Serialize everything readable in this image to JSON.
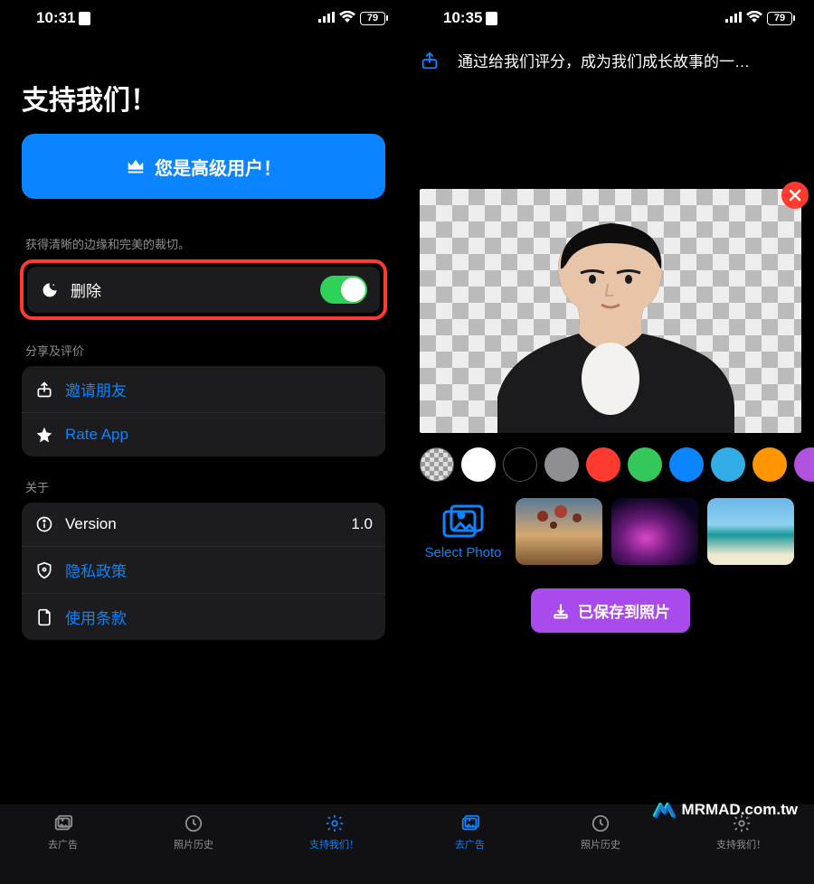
{
  "status": {
    "time_left": "10:31",
    "time_right": "10:35",
    "battery": "79"
  },
  "left": {
    "title": "支持我们！",
    "premium_label": "您是高级用户！",
    "edge_note": "获得清晰的边缘和完美的裁切。",
    "delete_label": "删除",
    "share_header": "分享及评价",
    "invite_label": "邀请朋友",
    "rate_label": "Rate App",
    "about_header": "关于",
    "version_label": "Version",
    "version_value": "1.0",
    "privacy_label": "隐私政策",
    "terms_label": "使用条款"
  },
  "right": {
    "banner_text": "通过给我们评分，成为我们成长故事的一…",
    "select_photo_label": "Select Photo",
    "save_label": "已保存到照片",
    "colors": [
      {
        "name": "transparent",
        "css": "checker"
      },
      {
        "name": "white",
        "css": "white"
      },
      {
        "name": "black",
        "css": "black"
      },
      {
        "name": "gray",
        "css": "gray"
      },
      {
        "name": "red",
        "hex": "#ff3b30"
      },
      {
        "name": "green",
        "hex": "#34c759"
      },
      {
        "name": "blue",
        "hex": "#0a84ff"
      },
      {
        "name": "cyan",
        "hex": "#32ade6"
      },
      {
        "name": "orange",
        "hex": "#ff9500"
      },
      {
        "name": "purple",
        "hex": "#af52de"
      }
    ]
  },
  "tabs": {
    "remove_ads": "去广告",
    "history": "照片历史",
    "support": "支持我们！"
  },
  "watermark": "MRMAD.com.tw"
}
